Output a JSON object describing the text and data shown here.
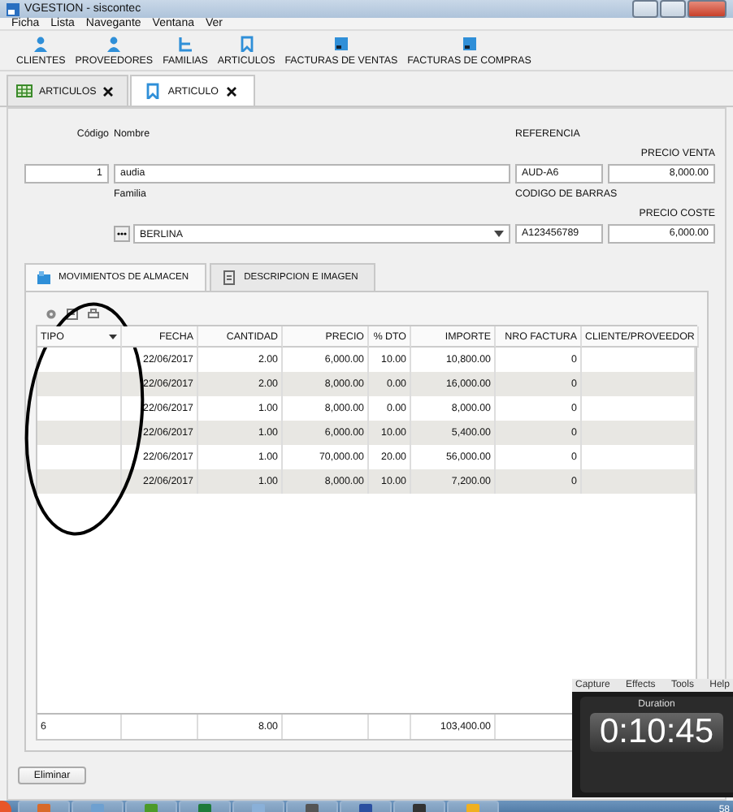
{
  "window": {
    "title": "VGESTION - siscontec"
  },
  "menu": [
    "Ficha",
    "Lista",
    "Navegante",
    "Ventana",
    "Ver"
  ],
  "toolbar": [
    {
      "label": "CLIENTES",
      "kind": "person"
    },
    {
      "label": "PROVEEDORES",
      "kind": "person"
    },
    {
      "label": "FAMILIAS",
      "kind": "tree"
    },
    {
      "label": "ARTICULOS",
      "kind": "bookmark"
    },
    {
      "label": "FACTURAS DE VENTAS",
      "kind": "document"
    },
    {
      "label": "FACTURAS DE COMPRAS",
      "kind": "document"
    }
  ],
  "doc_tabs": [
    {
      "label": "ARTICULOS",
      "kind": "grid",
      "selected": false
    },
    {
      "label": "ARTICULO",
      "kind": "bookmark",
      "selected": true
    }
  ],
  "form": {
    "codigo": {
      "label": "Código",
      "value": "1"
    },
    "nombre": {
      "label": "Nombre",
      "value": "audia"
    },
    "referencia": {
      "label": "REFERENCIA",
      "value": "AUD-A6"
    },
    "precio_venta": {
      "label": "PRECIO VENTA",
      "value": "8,000.00"
    },
    "familia": {
      "label": "Familia",
      "value": "BERLINA"
    },
    "codigo_barras": {
      "label": "CODIGO DE BARRAS",
      "value": "A123456789"
    },
    "precio_coste": {
      "label": "PRECIO COSTE",
      "value": "6,000.00"
    }
  },
  "sub_tabs": [
    {
      "label": "MOVIMIENTOS DE ALMACEN",
      "kind": "box",
      "selected": true
    },
    {
      "label": "DESCRIPCION E IMAGEN",
      "kind": "page",
      "selected": false
    }
  ],
  "table": {
    "columns": [
      "TIPO",
      "FECHA",
      "CANTIDAD",
      "PRECIO",
      "% DTO",
      "IMPORTE",
      "NRO FACTURA",
      "CLIENTE/PROVEEDOR"
    ],
    "rows": [
      {
        "fecha": "22/06/2017",
        "cantidad": "2.00",
        "precio": "6,000.00",
        "dto": "10.00",
        "importe": "10,800.00",
        "nro_factura": "0"
      },
      {
        "fecha": "22/06/2017",
        "cantidad": "2.00",
        "precio": "8,000.00",
        "dto": "0.00",
        "importe": "16,000.00",
        "nro_factura": "0"
      },
      {
        "fecha": "22/06/2017",
        "cantidad": "1.00",
        "precio": "8,000.00",
        "dto": "0.00",
        "importe": "8,000.00",
        "nro_factura": "0"
      },
      {
        "fecha": "22/06/2017",
        "cantidad": "1.00",
        "precio": "6,000.00",
        "dto": "10.00",
        "importe": "5,400.00",
        "nro_factura": "0"
      },
      {
        "fecha": "22/06/2017",
        "cantidad": "1.00",
        "precio": "70,000.00",
        "dto": "20.00",
        "importe": "56,000.00",
        "nro_factura": "0"
      },
      {
        "fecha": "22/06/2017",
        "cantidad": "1.00",
        "precio": "8,000.00",
        "dto": "10.00",
        "importe": "7,200.00",
        "nro_factura": "0"
      }
    ],
    "totals": {
      "tipo": "6",
      "cantidad": "8.00",
      "importe": "103,400.00"
    }
  },
  "buttons": [
    {
      "label": "Eliminar"
    }
  ],
  "capture_widget": {
    "menu": [
      "Capture",
      "Effects",
      "Tools",
      "Help"
    ],
    "label": "Duration",
    "time": "0:10:45"
  },
  "taskbar": {
    "clock": "58"
  }
}
